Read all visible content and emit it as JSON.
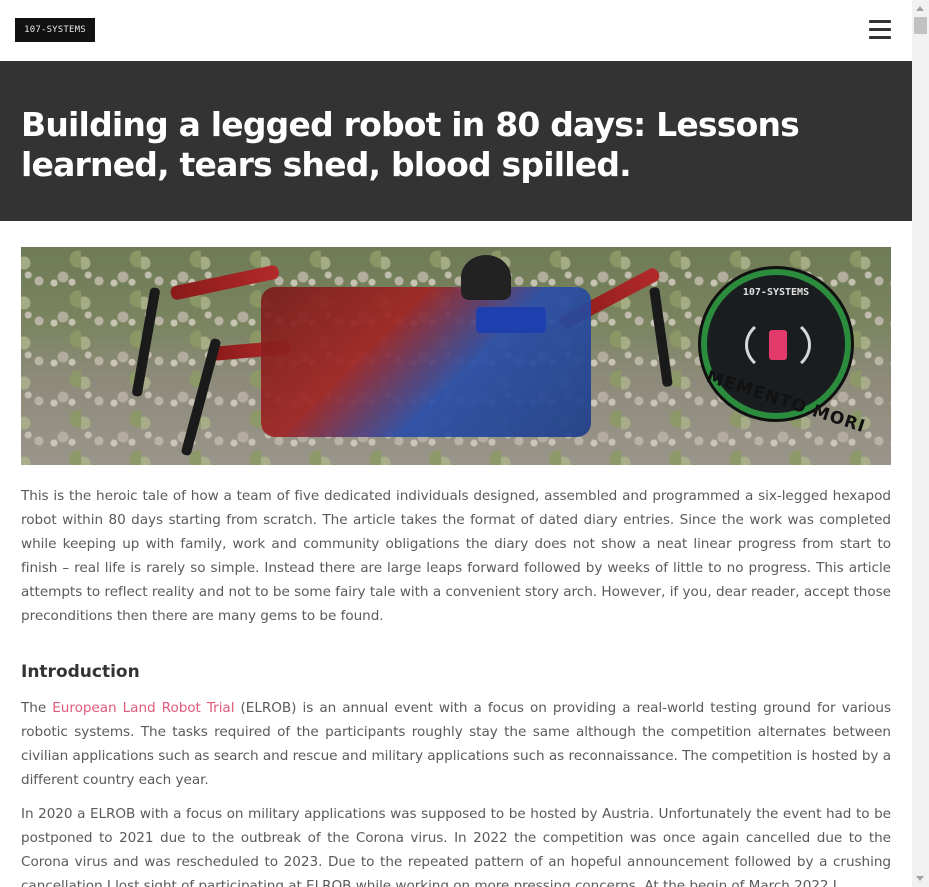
{
  "header": {
    "logo_text": "107-SYSTEMS",
    "menu_icon": "hamburger-icon"
  },
  "banner": {
    "title": "Building a legged robot in 80 days: Lessons learned, tears shed, blood spilled."
  },
  "hero": {
    "emblem_ring_text": "107-SYSTEMS",
    "emblem_motto": "MEMENTO MORI",
    "accent_green": "#2c8c3d",
    "accent_pink": "#e23b6b"
  },
  "article": {
    "intro_paragraph": "This is the heroic tale of how a team of five dedicated individuals designed, assembled and programmed a six-legged hexapod robot within 80 days starting from scratch. The article takes the format of dated diary entries. Since the work was completed while keeping up with family, work and community obligations the diary does not show a neat linear progress from start to finish – real life is rarely so simple. Instead there are large leaps forward followed by weeks of little to no progress. This article attempts to reflect reality and not to be some fairy tale with a convenient story arch. However, if you, dear reader, accept those preconditions then there are many gems to be found.",
    "section_heading": "Introduction",
    "para2_prefix": "The ",
    "para2_link": "European Land Robot Trial",
    "para2_rest": " (ELROB) is an annual event with a focus on providing a real-world testing ground for various robotic systems. The tasks required of the participants roughly stay the same although the competition alternates between civilian applications such as search and rescue and military applications such as reconnaissance. The competition is hosted by a different country each year.",
    "para3": "In 2020 a ELROB with a focus on military applications was supposed to be hosted by Austria. Unfortunately the event had to be postponed to 2021 due to the outbreak of the Corona virus. In 2022 the competition was once again cancelled due to the Corona virus and was rescheduled to 2023. Due to the repeated pattern of an hopeful announcement followed by a crushing cancellation I lost sight of participating at ELROB while working on more pressing concerns. At the begin of March 2022 I",
    "link_color": "#e05a7a"
  }
}
